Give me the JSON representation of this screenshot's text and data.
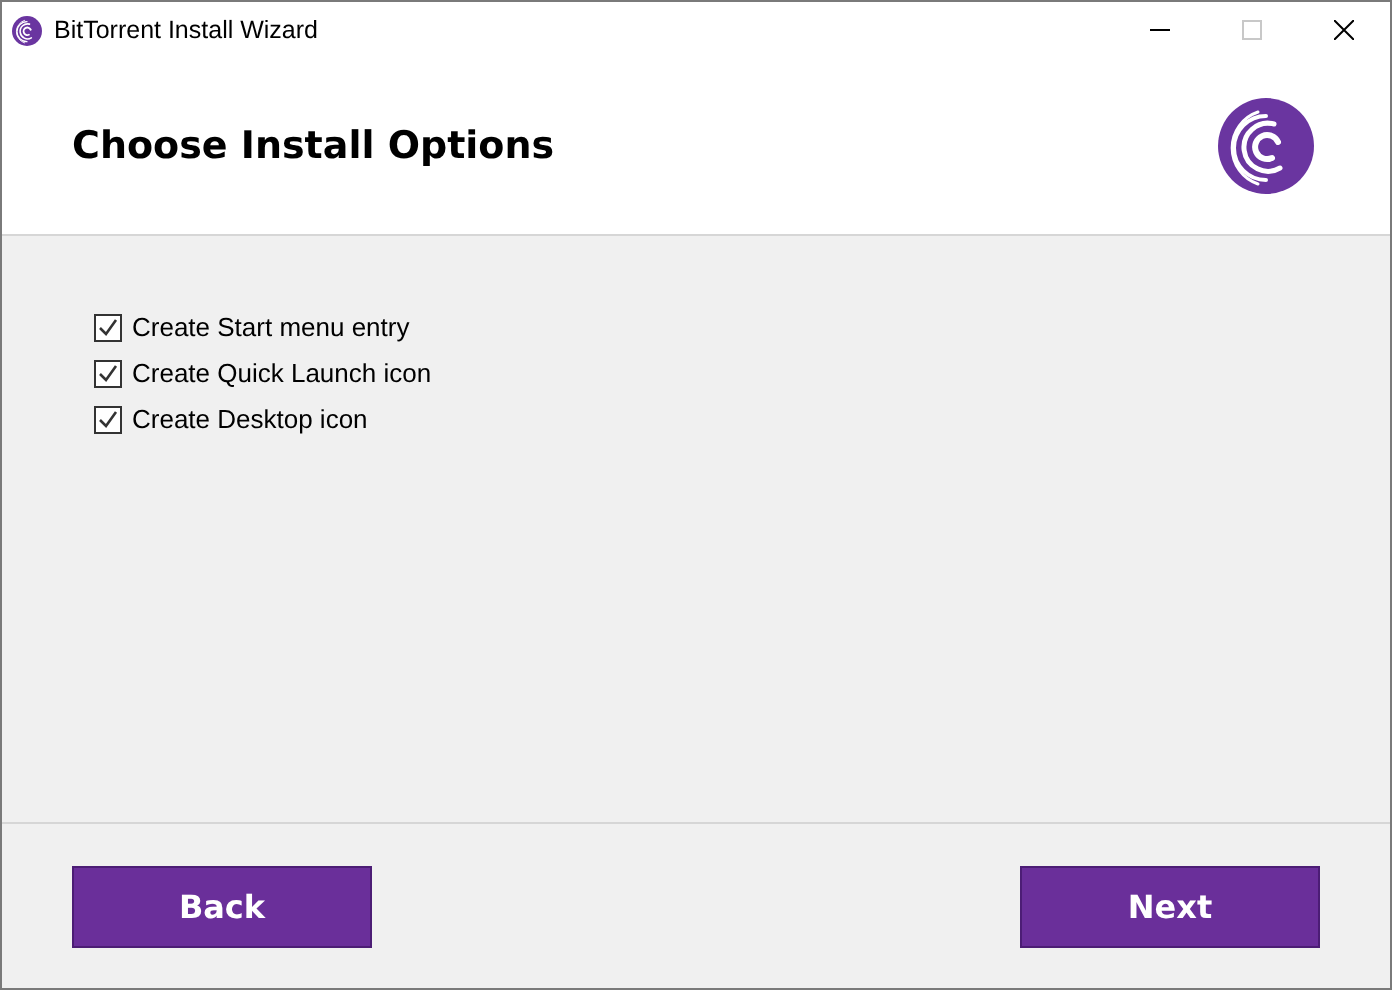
{
  "window": {
    "title": "BitTorrent Install Wizard",
    "controls": [
      {
        "kind": "minimize",
        "disabled": false
      },
      {
        "kind": "maximize",
        "disabled": true
      },
      {
        "kind": "close",
        "disabled": false
      }
    ]
  },
  "header": {
    "title": "Choose Install Options"
  },
  "options": [
    {
      "label": "Create Start menu entry",
      "checked": true
    },
    {
      "label": "Create Quick Launch icon",
      "checked": true
    },
    {
      "label": "Create Desktop icon",
      "checked": true
    }
  ],
  "buttons": [
    {
      "label": "Back"
    },
    {
      "label": "Next"
    }
  ]
}
